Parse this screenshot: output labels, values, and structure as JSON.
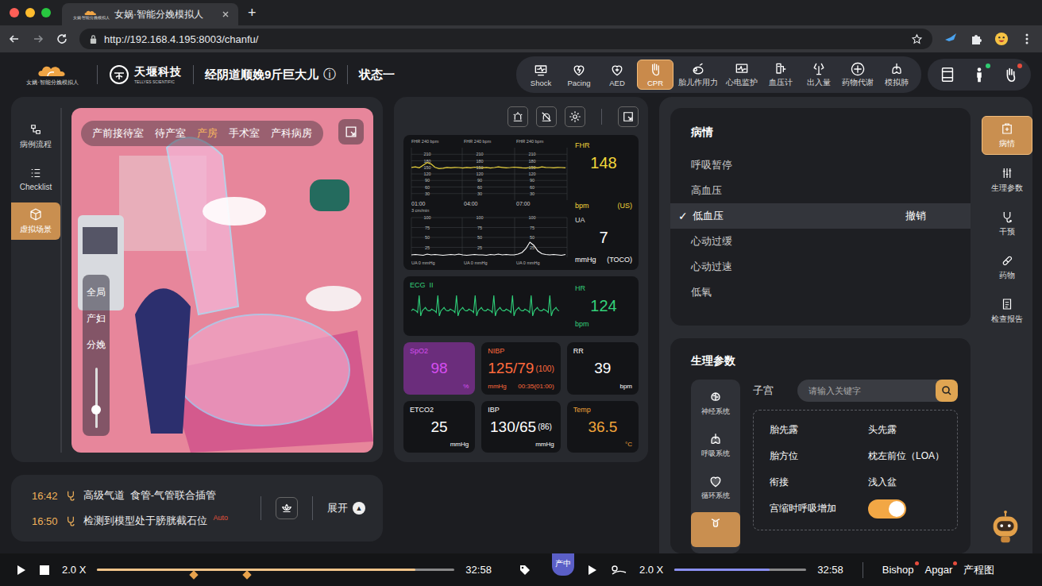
{
  "browser": {
    "tab_title": "女娲·智能分娩模拟人",
    "tab_icon_text": "女娲·智能分娩模拟人",
    "new_tab": "+",
    "url": "http://192.168.4.195:8003/chanfu/"
  },
  "header": {
    "logo_text": "女娲·智能分娩模拟人",
    "brand": "天堰科技",
    "brand_en": "TELLYES SCIENTIFIC",
    "title": "经阴道顺娩9斤巨大儿",
    "info": "ⓘ",
    "state": "状态一",
    "tools": [
      {
        "label": "Shock",
        "selected": false
      },
      {
        "label": "Pacing",
        "selected": false
      },
      {
        "label": "AED",
        "selected": false
      },
      {
        "label": "CPR",
        "selected": true
      },
      {
        "label": "胎儿作用力",
        "selected": false
      },
      {
        "label": "心电监护",
        "selected": false
      },
      {
        "label": "血压计",
        "selected": false
      },
      {
        "label": "出入量",
        "selected": false
      },
      {
        "label": "药物代谢",
        "selected": false
      },
      {
        "label": "模拟肺",
        "selected": false
      }
    ],
    "user_tools": [
      {
        "badge": false,
        "color": "#000000"
      },
      {
        "badge": true,
        "color": "#2ecc71"
      },
      {
        "badge": true,
        "color": "#e74c3c"
      }
    ]
  },
  "sidebar": [
    {
      "label": "病例流程",
      "selected": false
    },
    {
      "label": "Checklist",
      "selected": false
    },
    {
      "label": "虚拟场景",
      "selected": true
    }
  ],
  "scene": {
    "rooms": [
      {
        "label": "产前接待室",
        "selected": false
      },
      {
        "label": "待产室",
        "selected": false
      },
      {
        "label": "产房",
        "selected": true
      },
      {
        "label": "手术室",
        "selected": false
      },
      {
        "label": "产科病房",
        "selected": false
      }
    ],
    "views": [
      "全局",
      "产妇",
      "分娩"
    ],
    "zoom_level": 0.3
  },
  "monitor": {
    "fhr": {
      "label": "FHR",
      "value": "148",
      "unit": "bpm",
      "mode": "(US)",
      "headers": [
        "FHR 240 bpm",
        "FHR 240 bpm",
        "FHR 240 bpm"
      ],
      "ticks": [
        "210",
        "180",
        "150",
        "120",
        "90",
        "60",
        "30"
      ],
      "times": [
        "01:00",
        "04:00",
        "07:00"
      ],
      "speed": "3 cm/min",
      "values": [
        150,
        152,
        148,
        160,
        172,
        165,
        150,
        144,
        146,
        150,
        148,
        150,
        149,
        147,
        150,
        148,
        151,
        149,
        148,
        150,
        147,
        149,
        152,
        150,
        148,
        149,
        151,
        150,
        148,
        147,
        149,
        150,
        148,
        152,
        150,
        149,
        148,
        150,
        149,
        148
      ]
    },
    "ua": {
      "label": "UA",
      "value": "7",
      "unit": "mmHg",
      "mode": "(TOCO)",
      "ticks": [
        "100",
        "75",
        "50",
        "25"
      ],
      "footers": [
        "UA 0 mmHg",
        "UA 0 mmHg",
        "UA 0 mmHg"
      ],
      "values": [
        6,
        7,
        6,
        5,
        8,
        6,
        7,
        6,
        5,
        6,
        7,
        6,
        8,
        6,
        5,
        6,
        7,
        6,
        6,
        5,
        7,
        6,
        8,
        6,
        7,
        6,
        6,
        8,
        12,
        22,
        38,
        30,
        16,
        9,
        7,
        6,
        7,
        6,
        5,
        7
      ]
    },
    "ecg": {
      "label": "ECG  II",
      "hr_label": "HR",
      "value": "124",
      "unit": "bpm",
      "values": [
        0,
        0.1,
        0.05,
        0,
        -0.1,
        0.9,
        -0.3,
        0,
        0.1,
        0.2,
        0.05,
        0,
        0,
        0.1,
        0.05,
        0,
        -0.1,
        0.9,
        -0.3,
        0,
        0.1,
        0.2,
        0.05,
        0,
        0,
        0.1,
        0.05,
        0,
        -0.1,
        0.9,
        -0.3,
        0,
        0.1,
        0.2,
        0.05,
        0,
        0,
        0.1,
        0.05,
        0,
        -0.1,
        0.9,
        -0.3,
        0,
        0.1,
        0.2,
        0.05,
        0,
        0,
        0.1,
        0.05,
        0,
        -0.1,
        0.9,
        -0.3,
        0,
        0.1,
        0.2,
        0.05,
        0,
        0,
        0.1,
        0.05,
        0,
        -0.1,
        0.9,
        -0.3,
        0,
        0.1,
        0.2,
        0.05,
        0,
        0,
        0.1,
        0.05,
        0,
        -0.1,
        0.9,
        -0.3,
        0,
        0.1,
        0.2,
        0.05,
        0,
        0,
        0.1,
        0.05,
        0,
        -0.1,
        0.9,
        -0.3,
        0,
        0.1,
        0.2,
        0.05,
        0
      ]
    },
    "tiles": [
      {
        "label": "SpO2",
        "value": "98",
        "unit": "%",
        "color": "#d54ef0",
        "alarm": true
      },
      {
        "label": "NIBP",
        "value": "125/79",
        "sub": "(100)",
        "unit": "mmHg",
        "extra": "00:35(01:00)",
        "color": "#ff6a3d",
        "alarm": false
      },
      {
        "label": "RR",
        "value": "39",
        "unit": "bpm",
        "color": "#ffffff",
        "alarm": false
      },
      {
        "label": "ETCO2",
        "value": "25",
        "unit": "mmHg",
        "color": "#ffffff",
        "alarm": false
      },
      {
        "label": "IBP",
        "value": "130/65",
        "sub": "(86)",
        "unit": "mmHg",
        "color": "#ffffff",
        "alarm": false
      },
      {
        "label": "Temp",
        "value": "36.5",
        "unit": "°C",
        "color": "#f2a43a",
        "alarm": false
      }
    ]
  },
  "log": {
    "entries": [
      {
        "time": "16:42",
        "text": "高级气道  食管-气管联合插管"
      },
      {
        "time": "16:50",
        "text": "检测到模型处于膀胱截石位",
        "tag": "Auto"
      }
    ],
    "expand": "展开",
    "expand_icon": "▲"
  },
  "conditions": {
    "title": "病情",
    "check_mark": "✓",
    "undo": "撤销",
    "items": [
      {
        "label": "呼吸暂停",
        "checked": false
      },
      {
        "label": "高血压",
        "checked": false
      },
      {
        "label": "低血压",
        "checked": true
      },
      {
        "label": "心动过缓",
        "checked": false
      },
      {
        "label": "心动过速",
        "checked": false
      },
      {
        "label": "低氧",
        "checked": false
      }
    ]
  },
  "right_nav": [
    {
      "label": "病情",
      "selected": true
    },
    {
      "label": "生理参数",
      "selected": false
    },
    {
      "label": "干预",
      "selected": false
    },
    {
      "label": "药物",
      "selected": false
    },
    {
      "label": "检查报告",
      "selected": false
    }
  ],
  "physio": {
    "title": "生理参数",
    "systems": [
      {
        "label": "神经系统",
        "selected": false
      },
      {
        "label": "呼吸系统",
        "selected": false
      },
      {
        "label": "循环系统",
        "selected": false
      },
      {
        "selected": true
      }
    ],
    "category": "子宫",
    "search_placeholder": "请输入关键字",
    "params": [
      {
        "kind": "text",
        "name": "胎先露",
        "value": "头先露"
      },
      {
        "kind": "text",
        "name": "胎方位",
        "value": "枕左前位（LOA）"
      },
      {
        "kind": "text",
        "name": "衔接",
        "value": "浅入盆"
      },
      {
        "kind": "toggle",
        "name": "宫缩时呼吸增加",
        "on": true
      }
    ]
  },
  "playback": {
    "left": {
      "speed": "2.0 X",
      "time": "32:58",
      "level": 0.89,
      "markers": [
        0.27,
        0.42
      ]
    },
    "right": {
      "stage": "产中",
      "speed": "2.0 X",
      "time": "32:58",
      "level": 0.72
    }
  },
  "bottom_links": [
    {
      "label": "Bishop",
      "badge": true
    },
    {
      "label": "Apgar",
      "badge": true
    },
    {
      "label": "产程图",
      "badge": false
    }
  ]
}
